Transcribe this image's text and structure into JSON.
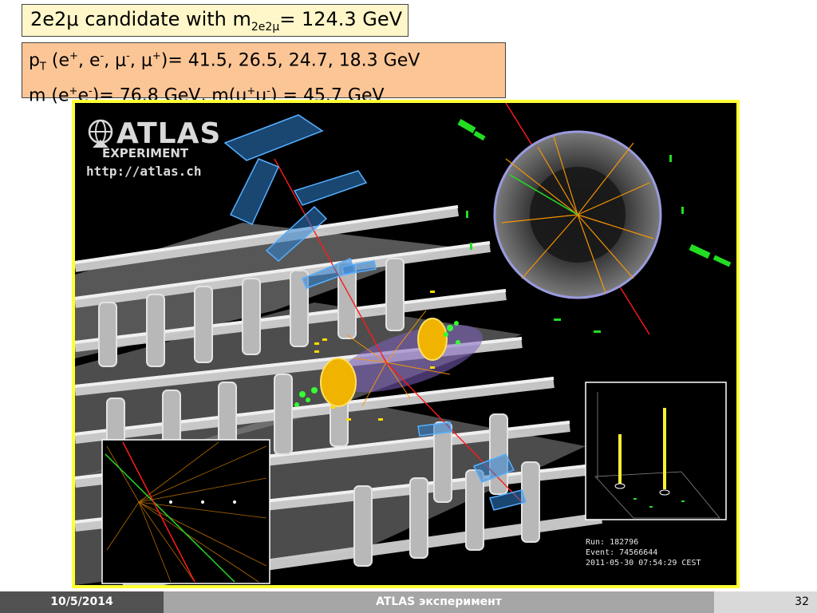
{
  "title": {
    "prefix": "2e2μ candidate with m",
    "subscript": "2e2μ",
    "suffix": "= 124.3 GeV"
  },
  "info": {
    "line1": {
      "p": "p",
      "T": "T",
      "paren_open": " (e",
      "plus1": "+",
      "comma1": ", e",
      "minus1": "-",
      "comma2": ", μ",
      "minus2": "-",
      "comma3": ", μ",
      "plus2": "+",
      "values": ")= 41.5, 26.5, 24.7, 18.3 GeV"
    },
    "line2": {
      "m": "m (e",
      "plus1": "+",
      "e2": "e",
      "minus1": "-",
      "mid": ")= 76.8 GeV, m(μ",
      "plus2": "+",
      "mu2": "μ",
      "minus2": "-",
      "end": ") = 45.7 GeV"
    }
  },
  "event_display": {
    "logo": {
      "atlas": "ATLAS",
      "experiment": "EXPERIMENT",
      "url": "http://atlas.ch"
    },
    "run_info": {
      "run": "Run: 182796",
      "event": "Event: 74566644",
      "date": "2011-05-30 07:54:29 CEST"
    },
    "colors": {
      "frame": "#ffff33",
      "track_orange": "#ff9900",
      "electron_track": "#00cc00",
      "muon_track": "#ff1a1a",
      "muon_chambers": "#3399dd",
      "calorimeter": "#ffcc00",
      "lego_bar": "#ffee33"
    }
  },
  "footer": {
    "date": "10/5/2014",
    "title": "ATLAS эксперимент",
    "page": "32"
  }
}
